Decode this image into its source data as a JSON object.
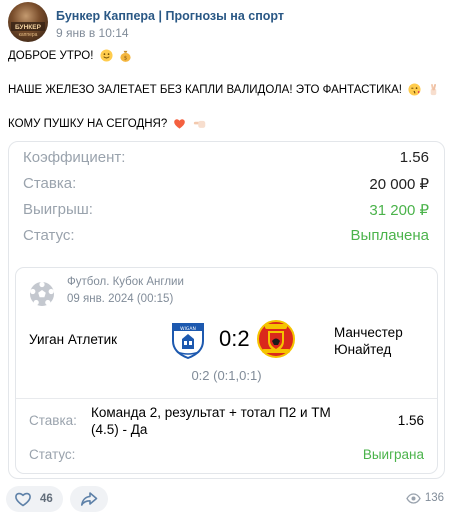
{
  "header": {
    "author": "Бункер Каппера | Прогнозы на спорт",
    "date": "9 янв в 10:14",
    "avatar_icon": "bunker-logo"
  },
  "post": {
    "line1": "ДОБРОЕ УТРО!",
    "line2": "НАШЕ ЖЕЛЕЗО ЗАЛЕТАЕТ БЕЗ КАПЛИ ВАЛИДОЛА! ЭТО ФАНТАСТИКА!",
    "line3": "КОМУ ПУШКУ НА СЕГОДНЯ?",
    "emoji_names": [
      "smiling-face-icon",
      "money-bag-icon",
      "winking-kiss-icon",
      "crossed-fingers-icon",
      "heart-icon",
      "pointing-left-icon"
    ]
  },
  "card": {
    "rows": [
      {
        "label": "Коэффициент:",
        "value": "1.56"
      },
      {
        "label": "Ставка:",
        "value": "20 000 ₽"
      },
      {
        "label": "Выигрыш:",
        "value": "31 200 ₽"
      },
      {
        "label": "Статус:",
        "value": "Выплачена"
      }
    ],
    "match": {
      "league": "Футбол. Кубок Англии",
      "date": "09 янв. 2024 (00:15)",
      "team1": "Уиган Атлетик",
      "team2": "Манчестер Юнайтед",
      "score": "0:2",
      "halves": "0:2 (0:1,0:1)",
      "bet_label": "Ставка:",
      "bet_text": "Команда 2, результат + тотал П2 и ТМ (4.5) - Да",
      "bet_odds": "1.56",
      "status_label": "Статус:",
      "status_value": "Выиграна"
    }
  },
  "footer": {
    "likes": "46",
    "views": "136"
  },
  "colors": {
    "link": "#2a5885",
    "muted": "#818c99",
    "green": "#4bb34b"
  }
}
